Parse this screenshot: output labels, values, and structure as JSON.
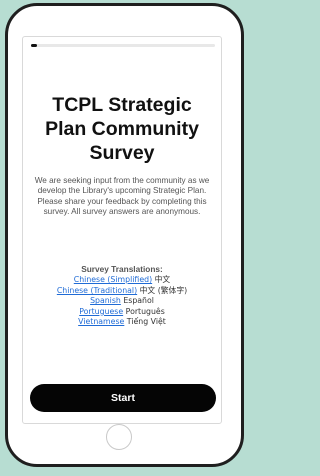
{
  "survey": {
    "progress_fraction": 0.03,
    "title": "TCPL Strategic Plan Community Survey",
    "description": "We are seeking input from the community as we develop the Library's upcoming Strategic Plan. Please share your feedback by completing this survey. All survey answers are anonymous.",
    "translations_heading": "Survey Translations:",
    "translations": [
      {
        "link": "Chinese (Simplified)",
        "native": "中文"
      },
      {
        "link": "Chinese (Traditional)",
        "native": "中文 (繁体字)"
      },
      {
        "link": "Spanish",
        "native": "Español"
      },
      {
        "link": "Portuguese",
        "native": "Português"
      },
      {
        "link": "Vietnamese",
        "native": "Tiếng Việt"
      }
    ],
    "start_label": "Start"
  },
  "colors": {
    "background": "#b7ddd2",
    "link": "#1f6bd6",
    "button": "#050505"
  }
}
